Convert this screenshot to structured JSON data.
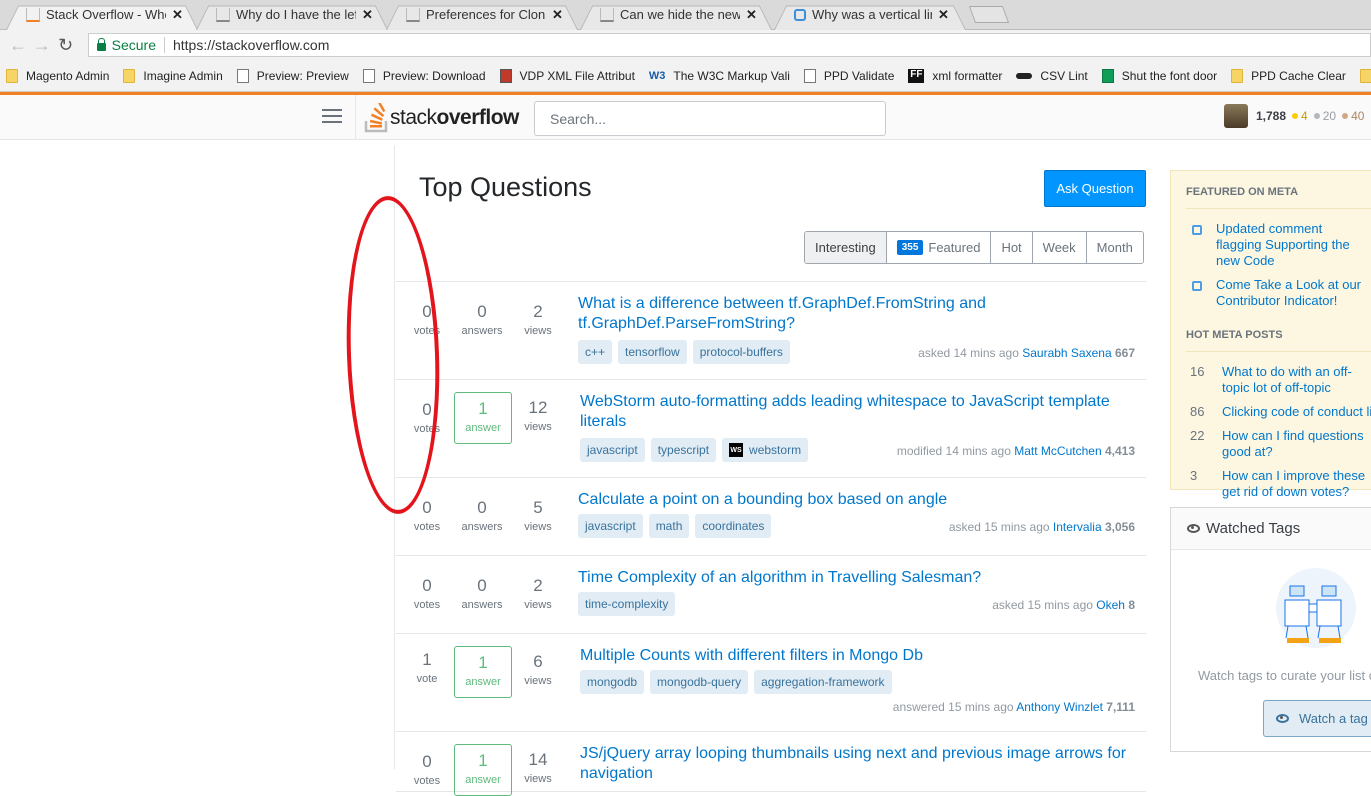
{
  "browser": {
    "tabs": [
      {
        "title": "Stack Overflow - Where D",
        "icon": "stackoverflow-icon",
        "active": true
      },
      {
        "title": "Why do I have the left na",
        "icon": "stackexchange-icon",
        "active": false
      },
      {
        "title": "Preferences for Clonkex -",
        "icon": "stackexchange-icon",
        "active": false
      },
      {
        "title": "Can we hide the new line",
        "icon": "stackexchange-icon",
        "active": false
      },
      {
        "title": "Why was a vertical line ac",
        "icon": "meta-icon",
        "active": false
      }
    ],
    "address": {
      "secure_label": "Secure",
      "url": "https://stackoverflow.com"
    },
    "bookmarks": [
      {
        "label": "Magento Admin",
        "icon": "folder"
      },
      {
        "label": "Imagine Admin",
        "icon": "folder"
      },
      {
        "label": "Preview: Preview",
        "icon": "page"
      },
      {
        "label": "Preview: Download",
        "icon": "page"
      },
      {
        "label": "VDP XML File Attribut",
        "icon": "vdp"
      },
      {
        "label": "The W3C Markup Vali",
        "icon": "w3"
      },
      {
        "label": "PPD Validate",
        "icon": "page"
      },
      {
        "label": "xml formatter",
        "icon": "ff"
      },
      {
        "label": "CSV Lint",
        "icon": "csv"
      },
      {
        "label": "Shut the font door",
        "icon": "sheet"
      },
      {
        "label": "PPD Cache Clear",
        "icon": "folder"
      }
    ]
  },
  "header": {
    "logo_light": "stack",
    "logo_bold": "overflow",
    "search_placeholder": "Search...",
    "reputation": "1,788",
    "gold": "4",
    "silver": "20",
    "bronze": "40",
    "colors": {
      "gold": "#ffcc01",
      "silver": "#b4b8bc",
      "bronze": "#d1a684"
    }
  },
  "main": {
    "title": "Top Questions",
    "ask_button": "Ask Question",
    "filters": [
      {
        "label": "Interesting",
        "badge": null
      },
      {
        "label": "Featured",
        "badge": "355"
      },
      {
        "label": "Hot",
        "badge": null
      },
      {
        "label": "Week",
        "badge": null
      },
      {
        "label": "Month",
        "badge": null
      }
    ],
    "questions": [
      {
        "votes": "0",
        "votes_label": "votes",
        "answers": "0",
        "answers_label": "answers",
        "answered": false,
        "views": "2",
        "views_label": "views",
        "title": "What is a difference between tf.GraphDef.FromString and tf.GraphDef.ParseFromString?",
        "tags": [
          "c++",
          "tensorflow",
          "protocol-buffers"
        ],
        "action": "asked 14 mins ago",
        "user": "Saurabh Saxena",
        "rep": "667"
      },
      {
        "votes": "0",
        "votes_label": "votes",
        "answers": "1",
        "answers_label": "answer",
        "answered": true,
        "views": "12",
        "views_label": "views",
        "title": "WebStorm auto-formatting adds leading whitespace to JavaScript template literals",
        "tags": [
          "javascript",
          "typescript",
          "webstorm"
        ],
        "action": "modified 14 mins ago",
        "user": "Matt McCutchen",
        "rep": "4,413"
      },
      {
        "votes": "0",
        "votes_label": "votes",
        "answers": "0",
        "answers_label": "answers",
        "answered": false,
        "views": "5",
        "views_label": "views",
        "title": "Calculate a point on a bounding box based on angle",
        "tags": [
          "javascript",
          "math",
          "coordinates"
        ],
        "action": "asked 15 mins ago",
        "user": "Intervalia",
        "rep": "3,056"
      },
      {
        "votes": "0",
        "votes_label": "votes",
        "answers": "0",
        "answers_label": "answers",
        "answered": false,
        "views": "2",
        "views_label": "views",
        "title": "Time Complexity of an algorithm in Travelling Salesman?",
        "tags": [
          "time-complexity"
        ],
        "action": "asked 15 mins ago",
        "user": "Okeh",
        "rep": "8"
      },
      {
        "votes": "1",
        "votes_label": "vote",
        "answers": "1",
        "answers_label": "answer",
        "answered": true,
        "views": "6",
        "views_label": "views",
        "title": "Multiple Counts with different filters in Mongo Db",
        "tags": [
          "mongodb",
          "mongodb-query",
          "aggregation-framework"
        ],
        "action": "answered 15 mins ago",
        "user": "Anthony Winzlet",
        "rep": "7,111"
      },
      {
        "votes": "0",
        "votes_label": "votes",
        "answers": "1",
        "answers_label": "answer",
        "answered": true,
        "views": "14",
        "views_label": "views",
        "title": "JS/jQuery array looping thumbnails using next and previous image arrows for navigation",
        "tags": [],
        "action": "",
        "user": "",
        "rep": ""
      }
    ]
  },
  "sidebar": {
    "featured_heading": "FEATURED ON META",
    "featured": [
      "Updated comment flagging Supporting the new Code",
      "Come Take a Look at our Contributor Indicator!"
    ],
    "hot_heading": "HOT META POSTS",
    "hot": [
      {
        "score": "16",
        "title": "What to do with an off-topic lot of off-topic questions in"
      },
      {
        "score": "86",
        "title": "Clicking code of conduct li"
      },
      {
        "score": "22",
        "title": "How can I find questions good at?"
      },
      {
        "score": "3",
        "title": "How can I improve these get rid of down votes?"
      }
    ],
    "watched_heading": "Watched Tags",
    "watched_text": "Watch tags to curate your list o",
    "watch_button": "Watch a tag"
  }
}
